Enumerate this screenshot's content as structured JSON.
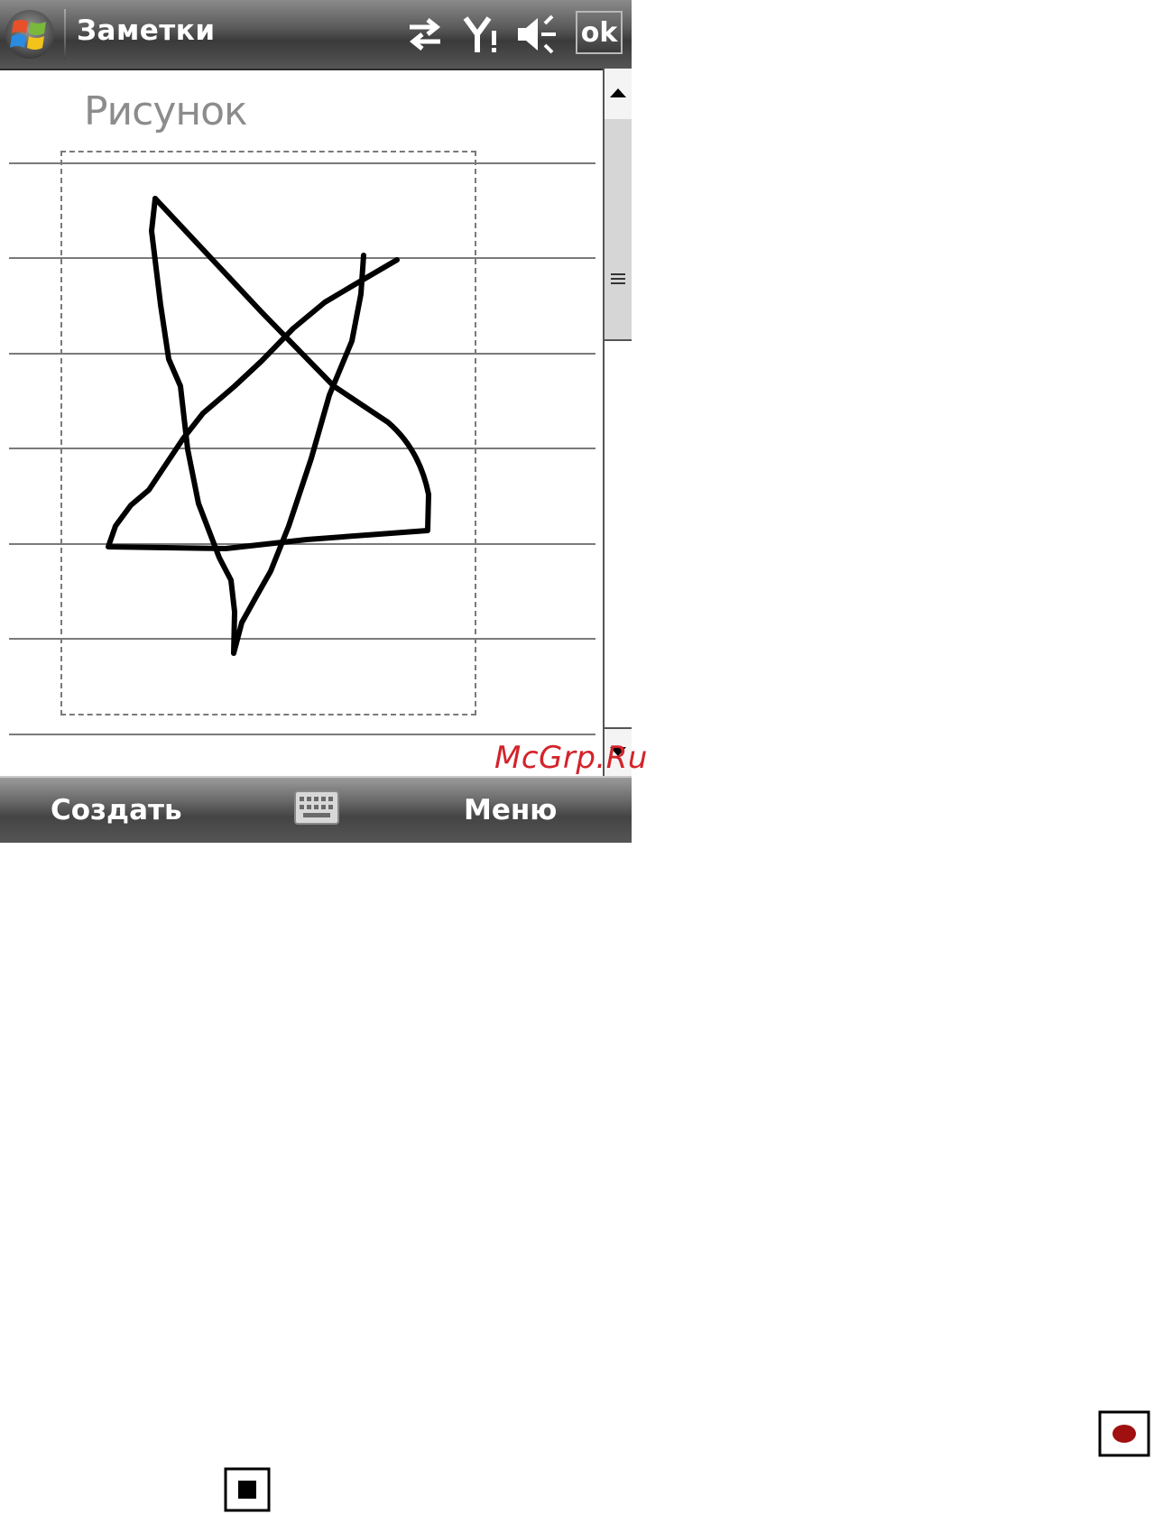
{
  "titlebar": {
    "app_title": "Заметки",
    "ok_label": "ok",
    "icons": [
      "windows-start-icon",
      "connectivity-arrows-icon",
      "signal-icon",
      "speaker-icon"
    ]
  },
  "note": {
    "heading": "Рисунок"
  },
  "softkeys": {
    "left_label": "Создать",
    "right_label": "Меню",
    "center_icon": "keyboard-icon"
  },
  "watermark": "McGrp.Ru",
  "page_icons": [
    "record-icon",
    "stop-icon"
  ],
  "colors": {
    "watermark": "#d3232b",
    "record_dot": "#a01010"
  }
}
